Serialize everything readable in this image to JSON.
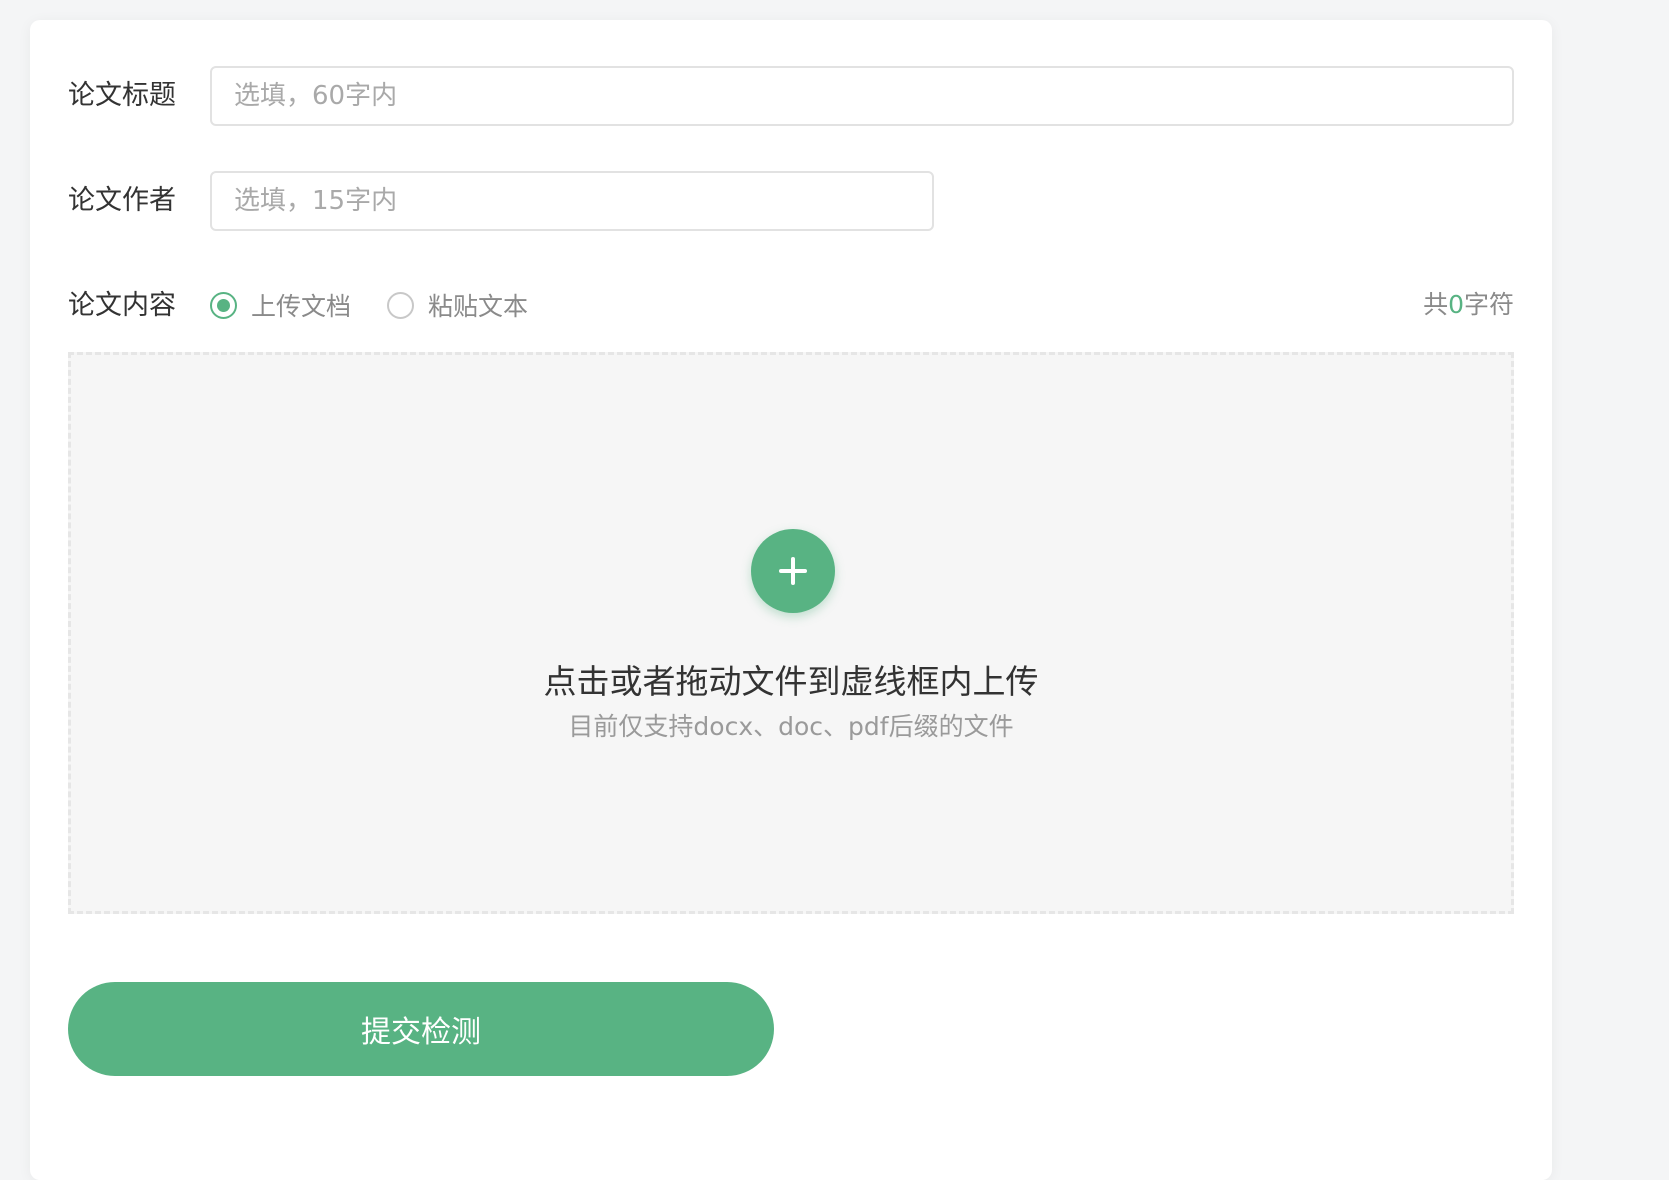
{
  "form": {
    "title_label": "论文标题",
    "title_placeholder": "选填，60字内",
    "title_value": "",
    "author_label": "论文作者",
    "author_placeholder": "选填，15字内",
    "author_value": "",
    "content_label": "论文内容",
    "content_modes": [
      {
        "label": "上传文档",
        "selected": true
      },
      {
        "label": "粘贴文本",
        "selected": false
      }
    ],
    "char_count": {
      "prefix": "共",
      "value": "0",
      "suffix": "字符"
    }
  },
  "upload": {
    "icon": "plus-icon",
    "title": "点击或者拖动文件到虚线框内上传",
    "hint": "目前仅支持docx、doc、pdf后缀的文件"
  },
  "submit_label": "提交检测",
  "colors": {
    "accent": "#58b383",
    "text": "#333333",
    "muted": "#8a8a8a",
    "border": "#e2e2e2",
    "upload_bg": "#f6f6f6"
  }
}
